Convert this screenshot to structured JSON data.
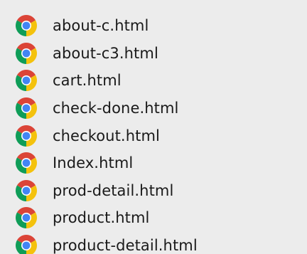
{
  "file_list": {
    "icon": "chrome-icon",
    "colors": {
      "red": "#db4437",
      "yellow": "#f4c20d",
      "green": "#0f9d58",
      "blue": "#4285f4",
      "background": "#ececec"
    },
    "items": [
      {
        "name": "about-c.html"
      },
      {
        "name": "about-c3.html"
      },
      {
        "name": "cart.html"
      },
      {
        "name": "check-done.html"
      },
      {
        "name": "checkout.html"
      },
      {
        "name": "Index.html"
      },
      {
        "name": "prod-detail.html"
      },
      {
        "name": "product.html"
      },
      {
        "name": "product-detail.html"
      }
    ]
  }
}
